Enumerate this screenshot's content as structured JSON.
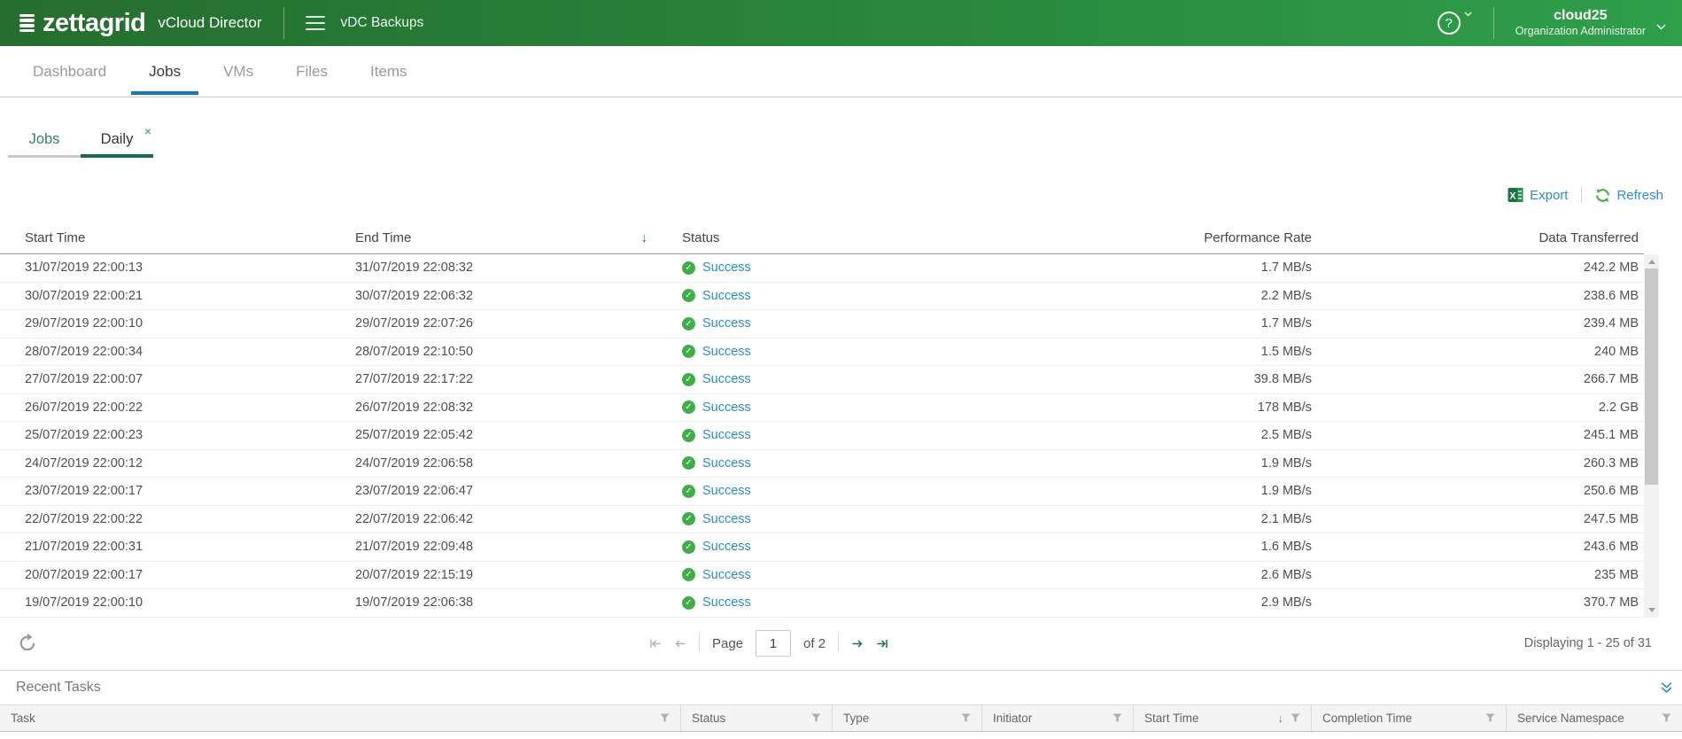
{
  "header": {
    "logo_text": "zettagrid",
    "product_name": "vCloud Director",
    "app_title": "vDC Backups",
    "user": {
      "name": "cloud25",
      "role": "Organization Administrator"
    }
  },
  "nav": {
    "tabs": [
      {
        "label": "Dashboard",
        "active": false
      },
      {
        "label": "Jobs",
        "active": true
      },
      {
        "label": "VMs",
        "active": false
      },
      {
        "label": "Files",
        "active": false
      },
      {
        "label": "Items",
        "active": false
      }
    ]
  },
  "subtabs": {
    "tabs": [
      {
        "label": "Jobs",
        "active": false,
        "closable": false
      },
      {
        "label": "Daily",
        "active": true,
        "closable": true
      }
    ]
  },
  "toolbar": {
    "export_label": "Export",
    "refresh_label": "Refresh"
  },
  "icons": {
    "sort_desc": "↓",
    "close": "×",
    "success_check": "✓",
    "help": "?"
  },
  "jobs_table": {
    "columns": [
      "Start Time",
      "End Time",
      "Status",
      "Performance Rate",
      "Data Transferred"
    ],
    "sort": {
      "column": "End Time",
      "direction": "desc"
    },
    "rows": [
      {
        "start": "31/07/2019 22:00:13",
        "end": "31/07/2019 22:08:32",
        "status": "Success",
        "rate": "1.7 MB/s",
        "transferred": "242.2 MB"
      },
      {
        "start": "30/07/2019 22:00:21",
        "end": "30/07/2019 22:06:32",
        "status": "Success",
        "rate": "2.2 MB/s",
        "transferred": "238.6 MB"
      },
      {
        "start": "29/07/2019 22:00:10",
        "end": "29/07/2019 22:07:26",
        "status": "Success",
        "rate": "1.7 MB/s",
        "transferred": "239.4 MB"
      },
      {
        "start": "28/07/2019 22:00:34",
        "end": "28/07/2019 22:10:50",
        "status": "Success",
        "rate": "1.5 MB/s",
        "transferred": "240 MB"
      },
      {
        "start": "27/07/2019 22:00:07",
        "end": "27/07/2019 22:17:22",
        "status": "Success",
        "rate": "39.8 MB/s",
        "transferred": "266.7 MB"
      },
      {
        "start": "26/07/2019 22:00:22",
        "end": "26/07/2019 22:08:32",
        "status": "Success",
        "rate": "178 MB/s",
        "transferred": "2.2 GB"
      },
      {
        "start": "25/07/2019 22:00:23",
        "end": "25/07/2019 22:05:42",
        "status": "Success",
        "rate": "2.5 MB/s",
        "transferred": "245.1 MB"
      },
      {
        "start": "24/07/2019 22:00:12",
        "end": "24/07/2019 22:06:58",
        "status": "Success",
        "rate": "1.9 MB/s",
        "transferred": "260.3 MB"
      },
      {
        "start": "23/07/2019 22:00:17",
        "end": "23/07/2019 22:06:47",
        "status": "Success",
        "rate": "1.9 MB/s",
        "transferred": "250.6 MB"
      },
      {
        "start": "22/07/2019 22:00:22",
        "end": "22/07/2019 22:06:42",
        "status": "Success",
        "rate": "2.1 MB/s",
        "transferred": "247.5 MB"
      },
      {
        "start": "21/07/2019 22:00:31",
        "end": "21/07/2019 22:09:48",
        "status": "Success",
        "rate": "1.6 MB/s",
        "transferred": "243.6 MB"
      },
      {
        "start": "20/07/2019 22:00:17",
        "end": "20/07/2019 22:15:19",
        "status": "Success",
        "rate": "2.6 MB/s",
        "transferred": "235 MB"
      },
      {
        "start": "19/07/2019 22:00:10",
        "end": "19/07/2019 22:06:38",
        "status": "Success",
        "rate": "2.9 MB/s",
        "transferred": "370.7 MB"
      }
    ]
  },
  "pagination": {
    "page_label": "Page",
    "page_value": "1",
    "of_label": "of 2",
    "summary": "Displaying 1 - 25 of 31"
  },
  "recent_tasks": {
    "title": "Recent Tasks",
    "columns": [
      {
        "label": "Task",
        "sorted": false
      },
      {
        "label": "Status",
        "sorted": false
      },
      {
        "label": "Type",
        "sorted": false
      },
      {
        "label": "Initiator",
        "sorted": false
      },
      {
        "label": "Start Time",
        "sorted": true
      },
      {
        "label": "Completion Time",
        "sorted": false
      },
      {
        "label": "Service Namespace",
        "sorted": false
      }
    ]
  },
  "colors": {
    "header_green": "#28823a",
    "nav_active_blue": "#1779b8",
    "link_blue": "#2d8cc9",
    "success_green": "#3fae49",
    "subtab_green": "#1a6b50",
    "excel_green": "#1e7145"
  }
}
